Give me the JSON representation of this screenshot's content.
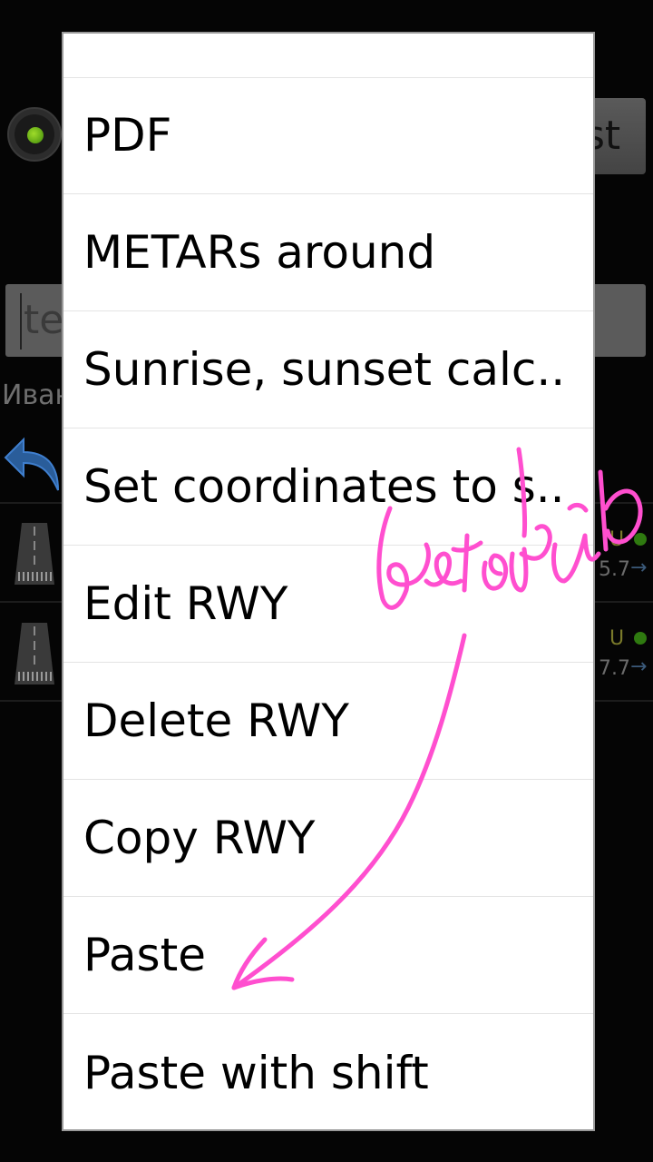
{
  "background": {
    "name_fragment": "Иван",
    "input_placeholder_fragment": "te",
    "button_fragment": "st",
    "rows": [
      {
        "status_letter": "U",
        "value_fragment": "5.7",
        "arrow": "→"
      },
      {
        "status_letter": "U",
        "value_fragment": "7.7",
        "arrow": "→"
      }
    ]
  },
  "menu": {
    "items": [
      {
        "label": "PDF"
      },
      {
        "label": "METARs around"
      },
      {
        "label": "Sunrise, sunset calc.."
      },
      {
        "label": "Set coordinates to s.."
      },
      {
        "label": "Edit RWY"
      },
      {
        "label": "Delete RWY"
      },
      {
        "label": "Copy RWY"
      },
      {
        "label": "Paste"
      },
      {
        "label": "Paste with shift"
      }
    ]
  },
  "annotation": {
    "color": "#ff4fcf"
  },
  "colors": {
    "menu_background": "#ffffff",
    "divider": "#e4e4e4",
    "led_green": "#7ec41f"
  }
}
